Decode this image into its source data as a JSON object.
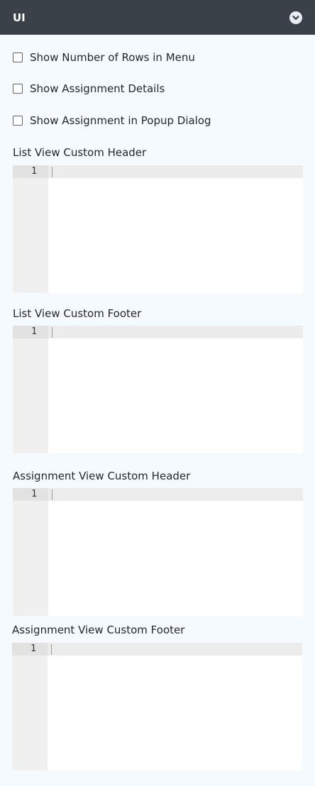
{
  "panel": {
    "title": "UI",
    "toggle_icon": "chevron-down-icon"
  },
  "options": [
    {
      "label": "Show Number of Rows in Menu",
      "checked": false
    },
    {
      "label": "Show Assignment Details",
      "checked": false
    },
    {
      "label": "Show Assignment in Popup Dialog",
      "checked": false
    }
  ],
  "editors": [
    {
      "label": "List View Custom Header",
      "line_number": "1"
    },
    {
      "label": "List View Custom Footer",
      "line_number": "1"
    },
    {
      "label": "Assignment View Custom Header",
      "line_number": "1"
    },
    {
      "label": "Assignment View Custom Footer",
      "line_number": "1"
    }
  ]
}
